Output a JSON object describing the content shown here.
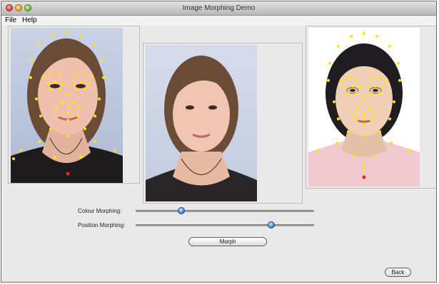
{
  "window": {
    "title": "Image Morphing Demo"
  },
  "menu": {
    "items": [
      "File",
      "Help"
    ]
  },
  "controls": {
    "colour_label": "Colour Morphing:",
    "colour_value": 0.26,
    "position_label": "Position Morphing:",
    "position_value": 0.77,
    "morph_button": "Morph",
    "back_button": "Back"
  },
  "images": {
    "left": {
      "description": "source face with feature points",
      "point_color": "#ffe600"
    },
    "middle": {
      "description": "morphed face"
    },
    "right": {
      "description": "target face with feature points",
      "point_color": "#ffe600"
    }
  },
  "colors": {
    "accent": "#3f88d6",
    "feature_point": "#ffe600",
    "feature_point_alt": "#ff2200"
  }
}
